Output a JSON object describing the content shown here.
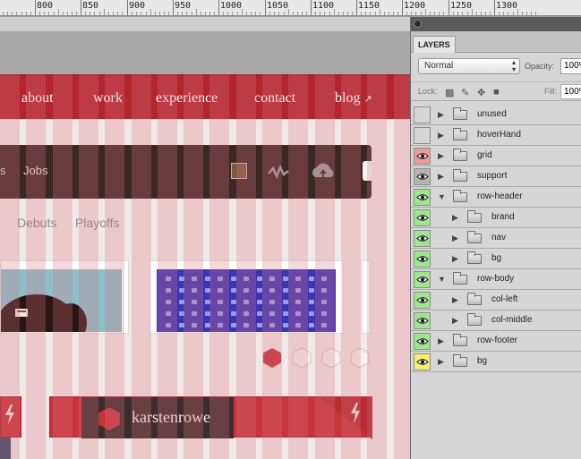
{
  "ruler": {
    "labels": [
      "800",
      "850",
      "900",
      "950",
      "1000",
      "1050",
      "1100",
      "1150",
      "1200",
      "1250",
      "1300"
    ]
  },
  "site": {
    "nav": [
      "about",
      "work",
      "experience",
      "contact",
      "blog"
    ],
    "subnav": {
      "jobs_label": "Jobs"
    },
    "tabs": [
      "Debuts",
      "Playoffs"
    ],
    "profile": {
      "username": "karstenrowe"
    },
    "brand_color": "#b3252f"
  },
  "layers_panel": {
    "tab_label": "LAYERS",
    "blend_mode": "Normal",
    "opacity_label": "Opacity:",
    "opacity_value": "100%",
    "lock_label": "Lock:",
    "fill_label": "Fill:",
    "fill_value": "100%",
    "layers": [
      {
        "name": "unused",
        "visible": false,
        "eye_color": "",
        "expanded": false
      },
      {
        "name": "hoverHand",
        "visible": false,
        "eye_color": "",
        "expanded": false
      },
      {
        "name": "grid",
        "visible": true,
        "eye_color": "#ee9a9a",
        "expanded": false
      },
      {
        "name": "support",
        "visible": true,
        "eye_color": "#b4b4b4",
        "expanded": false
      },
      {
        "name": "row-header",
        "visible": true,
        "eye_color": "#9de68f",
        "expanded": true
      },
      {
        "name": "brand",
        "visible": true,
        "eye_color": "#9de68f",
        "expanded": false
      },
      {
        "name": "nav",
        "visible": true,
        "eye_color": "#9de68f",
        "expanded": false
      },
      {
        "name": "bg",
        "visible": true,
        "eye_color": "#9de68f",
        "expanded": false
      },
      {
        "name": "row-body",
        "visible": true,
        "eye_color": "#9de68f",
        "expanded": true
      },
      {
        "name": "col-left",
        "visible": true,
        "eye_color": "#9de68f",
        "expanded": false
      },
      {
        "name": "col-middle",
        "visible": true,
        "eye_color": "#9de68f",
        "expanded": false
      },
      {
        "name": "row-footer",
        "visible": true,
        "eye_color": "#9de68f",
        "expanded": false
      },
      {
        "name": "bg",
        "visible": true,
        "eye_color": "#f5f06b",
        "expanded": false
      }
    ]
  }
}
